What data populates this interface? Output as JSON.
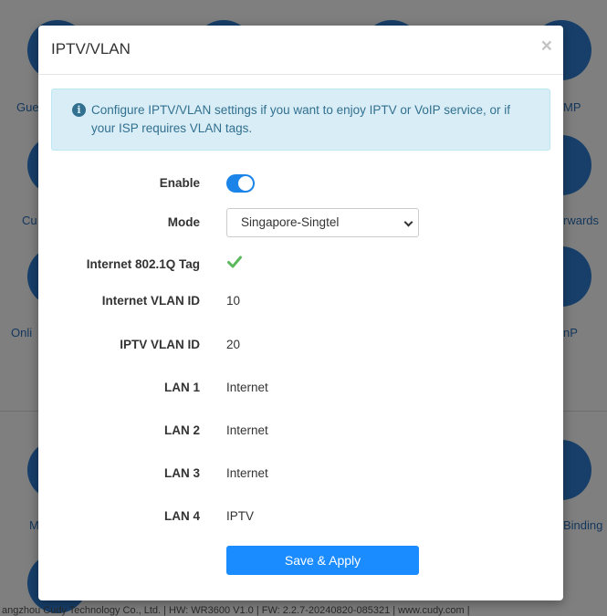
{
  "background": {
    "labels": [
      "Gue",
      "MP",
      "Cu",
      "rwards",
      "Onli",
      "nP",
      "M",
      "Binding"
    ],
    "footer": "angzhou Cudy Technology Co., Ltd. | HW: WR3600 V1.0 | FW: 2.2.7-20240820-085321 | www.cudy.com |"
  },
  "modal": {
    "title": "IPTV/VLAN",
    "close_symbol": "×",
    "alert": {
      "icon": "info-icon",
      "icon_glyph": "i",
      "text": "Configure IPTV/VLAN settings if you want to enjoy IPTV or VoIP service, or if your ISP requires VLAN tags."
    },
    "fields": {
      "enable": {
        "label": "Enable",
        "on": true
      },
      "mode": {
        "label": "Mode",
        "value": "Singapore-Singtel"
      },
      "internet_tag": {
        "label": "Internet 802.1Q Tag",
        "checked": true
      },
      "internet_vlan_id": {
        "label": "Internet VLAN ID",
        "value": "10"
      },
      "iptv_vlan_id": {
        "label": "IPTV VLAN ID",
        "value": "20"
      },
      "lan1": {
        "label": "LAN 1",
        "value": "Internet"
      },
      "lan2": {
        "label": "LAN 2",
        "value": "Internet"
      },
      "lan3": {
        "label": "LAN 3",
        "value": "Internet"
      },
      "lan4": {
        "label": "LAN 4",
        "value": "IPTV"
      }
    },
    "save_label": "Save & Apply"
  },
  "colors": {
    "accent": "#1a84e8",
    "button": "#1a8cff",
    "alert_bg": "#d9edf7",
    "alert_text": "#31708f",
    "check": "#5cb85c"
  }
}
